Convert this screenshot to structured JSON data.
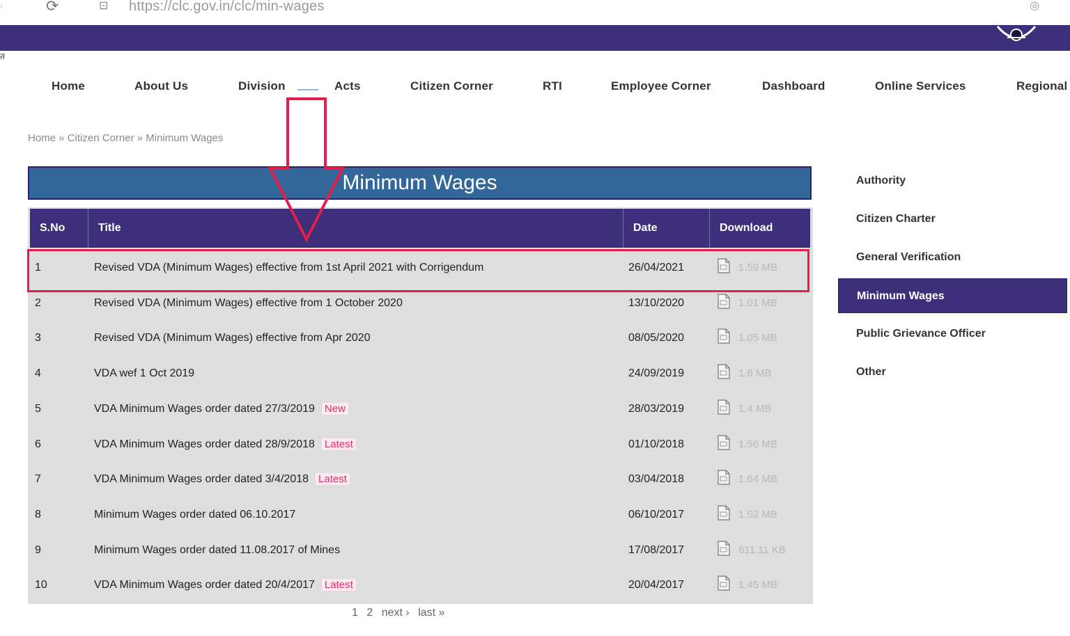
{
  "browser": {
    "url": "https://clc.gov.in/clc/min-wages",
    "reload_icon": "reload-icon",
    "site_info_icon": "site-info-icon",
    "profile_icon": "profile-icon"
  },
  "banner": {
    "color": "#3d2f79",
    "side_mark": "त"
  },
  "nav": {
    "items": [
      "Home",
      "About Us",
      "Division",
      "Acts",
      "Citizen Corner",
      "RTI",
      "Employee Corner",
      "Dashboard",
      "Online Services",
      "Regional"
    ]
  },
  "breadcrumb": {
    "home": "Home",
    "sep1": " » ",
    "citizen": "Citizen Corner",
    "sep2": " » ",
    "current": "Minimum Wages"
  },
  "page": {
    "title": "Minimum Wages"
  },
  "table": {
    "headers": {
      "sno": "S.No",
      "title": "Title",
      "date": "Date",
      "download": "Download"
    },
    "rows": [
      {
        "sno": "1",
        "title": "Revised VDA (Minimum Wages) effective from 1st April 2021 with Corrigendum",
        "badge": "",
        "date": "26/04/2021",
        "size": "1.59 MB"
      },
      {
        "sno": "2",
        "title": "Revised VDA (Minimum Wages) effective from 1 October 2020",
        "badge": "",
        "date": "13/10/2020",
        "size": "1.01 MB"
      },
      {
        "sno": "3",
        "title": "Revised VDA (Minimum Wages) effective from Apr 2020",
        "badge": "",
        "date": "08/05/2020",
        "size": "1.05 MB"
      },
      {
        "sno": "4",
        "title": "VDA wef 1 Oct 2019",
        "badge": "",
        "date": "24/09/2019",
        "size": "1.6 MB"
      },
      {
        "sno": "5",
        "title": "VDA Minimum Wages order dated 27/3/2019",
        "badge": "New",
        "date": "28/03/2019",
        "size": "1.4 MB"
      },
      {
        "sno": "6",
        "title": "VDA Minimum Wages order dated 28/9/2018",
        "badge": "Latest",
        "date": "01/10/2018",
        "size": "1.56 MB"
      },
      {
        "sno": "7",
        "title": "VDA Minimum Wages order dated 3/4/2018",
        "badge": "Latest",
        "date": "03/04/2018",
        "size": "1.64 MB"
      },
      {
        "sno": "8",
        "title": "Minimum Wages order dated 06.10.2017",
        "badge": "",
        "date": "06/10/2017",
        "size": "1.52 MB"
      },
      {
        "sno": "9",
        "title": "Minimum Wages order dated 11.08.2017 of Mines",
        "badge": "",
        "date": "17/08/2017",
        "size": "611.11 KB"
      },
      {
        "sno": "10",
        "title": "VDA Minimum Wages order dated 20/4/2017",
        "badge": "Latest",
        "date": "20/04/2017",
        "size": "1.45 MB"
      }
    ]
  },
  "pager": {
    "page1": "1",
    "page2": "2",
    "next": "next ›",
    "last": "last »"
  },
  "sidebar": {
    "items": [
      "Authority",
      "Citizen Charter",
      "General Verification",
      "Minimum Wages",
      "Public Grievance Officer",
      "Other"
    ],
    "active_index": 3
  },
  "colors": {
    "purple": "#3d2f79",
    "heading_blue": "#336699",
    "annotation_red": "#e21f4a"
  }
}
